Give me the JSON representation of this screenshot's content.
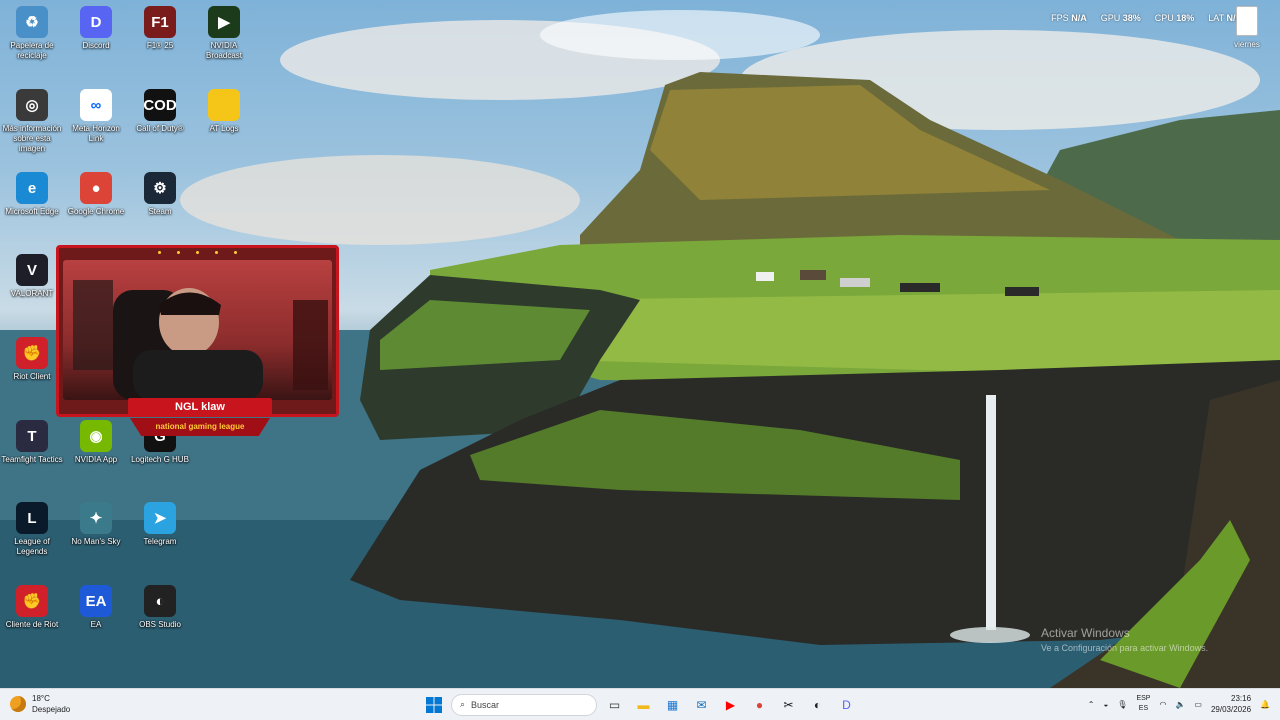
{
  "desktop_icons": [
    {
      "id": "recycle-bin",
      "label": "Papelera de reciclaje",
      "icon": "recycle-bin-icon",
      "color": "#4a90c8",
      "glyph": "♻"
    },
    {
      "id": "discord",
      "label": "Discord",
      "icon": "discord-icon",
      "color": "#5865f2",
      "glyph": "D"
    },
    {
      "id": "f1-25",
      "label": "F1® 25",
      "icon": "f1-game-icon",
      "color": "#7a1c1c",
      "glyph": "F1"
    },
    {
      "id": "nvidia-broadcast",
      "label": "NVIDIA Broadcast",
      "icon": "nvidia-broadcast-icon",
      "color": "#1b3b1b",
      "glyph": "▶"
    },
    {
      "id": "more-info",
      "label": "Más información sobre esta imagen",
      "icon": "info-camera-icon",
      "color": "#3a3a3a",
      "glyph": "◎"
    },
    {
      "id": "meta-horizon",
      "label": "Meta Horizon Link",
      "icon": "meta-icon",
      "color": "#ffffff",
      "glyph": "∞"
    },
    {
      "id": "call-of-duty",
      "label": "Call of Duty®",
      "icon": "call-of-duty-icon",
      "color": "#111111",
      "glyph": "COD"
    },
    {
      "id": "at-logs",
      "label": "AT Logs",
      "icon": "folder-icon",
      "color": "#f5c518",
      "glyph": ""
    },
    {
      "id": "edge",
      "label": "Microsoft Edge",
      "icon": "edge-icon",
      "color": "#1a8ad4",
      "glyph": "e"
    },
    {
      "id": "chrome",
      "label": "Google Chrome",
      "icon": "chrome-icon",
      "color": "#db4437",
      "glyph": "●"
    },
    {
      "id": "steam",
      "label": "Steam",
      "icon": "steam-icon",
      "color": "#1b2838",
      "glyph": "⚙"
    },
    {
      "id": "valorant",
      "label": "VALORANT",
      "icon": "valorant-icon",
      "color": "#1e1e28",
      "glyph": "V"
    },
    {
      "id": "riot-client",
      "label": "Riot Client",
      "icon": "riot-client-icon",
      "color": "#d0202a",
      "glyph": "✊"
    },
    {
      "id": "teamfight-tactics",
      "label": "Teamfight Tactics",
      "icon": "tft-icon",
      "color": "#2a2a40",
      "glyph": "T"
    },
    {
      "id": "nvidia-app",
      "label": "NVIDIA App",
      "icon": "nvidia-icon",
      "color": "#76b900",
      "glyph": "◉"
    },
    {
      "id": "logitech-ghub",
      "label": "Logitech G HUB",
      "icon": "logitech-g-icon",
      "color": "#111111",
      "glyph": "G"
    },
    {
      "id": "league-of-legends",
      "label": "League of Legends",
      "icon": "lol-icon",
      "color": "#0a1a2a",
      "glyph": "L"
    },
    {
      "id": "no-mans-sky",
      "label": "No Man's Sky",
      "icon": "no-mans-sky-icon",
      "color": "#3a7a8a",
      "glyph": "✦"
    },
    {
      "id": "telegram",
      "label": "Telegram",
      "icon": "telegram-icon",
      "color": "#2aa3e0",
      "glyph": "➤"
    },
    {
      "id": "cliente-de-riot",
      "label": "Cliente de Riot",
      "icon": "riot-client-icon",
      "color": "#d0202a",
      "glyph": "✊"
    },
    {
      "id": "ea",
      "label": "EA",
      "icon": "ea-icon",
      "color": "#1e5ad8",
      "glyph": "EA"
    },
    {
      "id": "obs-studio",
      "label": "OBS Studio",
      "icon": "obs-icon",
      "color": "#222222",
      "glyph": "◐"
    }
  ],
  "perf_overlay": {
    "fps_label": "FPS",
    "fps_value": "N/A",
    "gpu_label": "GPU",
    "gpu_value": "38%",
    "cpu_label": "CPU",
    "cpu_value": "18%",
    "lat_label": "LAT",
    "lat_value": "N/A"
  },
  "desktop_note": {
    "label": "viernes"
  },
  "webcam": {
    "name": "NGL klaw",
    "subtitle": "national gaming league",
    "accent": "#c8141c"
  },
  "watermark": {
    "title": "Activar Windows",
    "subtitle": "Ve a Configuración para activar Windows."
  },
  "taskbar": {
    "weather_temp": "18°C",
    "weather_desc": "Despejado",
    "search_placeholder": "Buscar",
    "lang_top": "ESP",
    "lang_bottom": "ES",
    "time": "23:16",
    "date": "29/03/2026",
    "pinned": [
      {
        "name": "task-view-icon",
        "color": "#333333",
        "glyph": "▭"
      },
      {
        "name": "file-explorer-icon",
        "color": "#f2b91a",
        "glyph": "▬"
      },
      {
        "name": "store-icon",
        "color": "#1976d2",
        "glyph": "▦"
      },
      {
        "name": "outlook-icon",
        "color": "#0f6cbd",
        "glyph": "✉"
      },
      {
        "name": "youtube-icon",
        "color": "#ff0000",
        "glyph": "▶"
      },
      {
        "name": "chrome-icon",
        "color": "#db4437",
        "glyph": "●"
      },
      {
        "name": "capcut-icon",
        "color": "#111111",
        "glyph": "✂"
      },
      {
        "name": "obs-icon",
        "color": "#222222",
        "glyph": "◐"
      },
      {
        "name": "discord-icon",
        "color": "#5865f2",
        "glyph": "D"
      }
    ]
  }
}
